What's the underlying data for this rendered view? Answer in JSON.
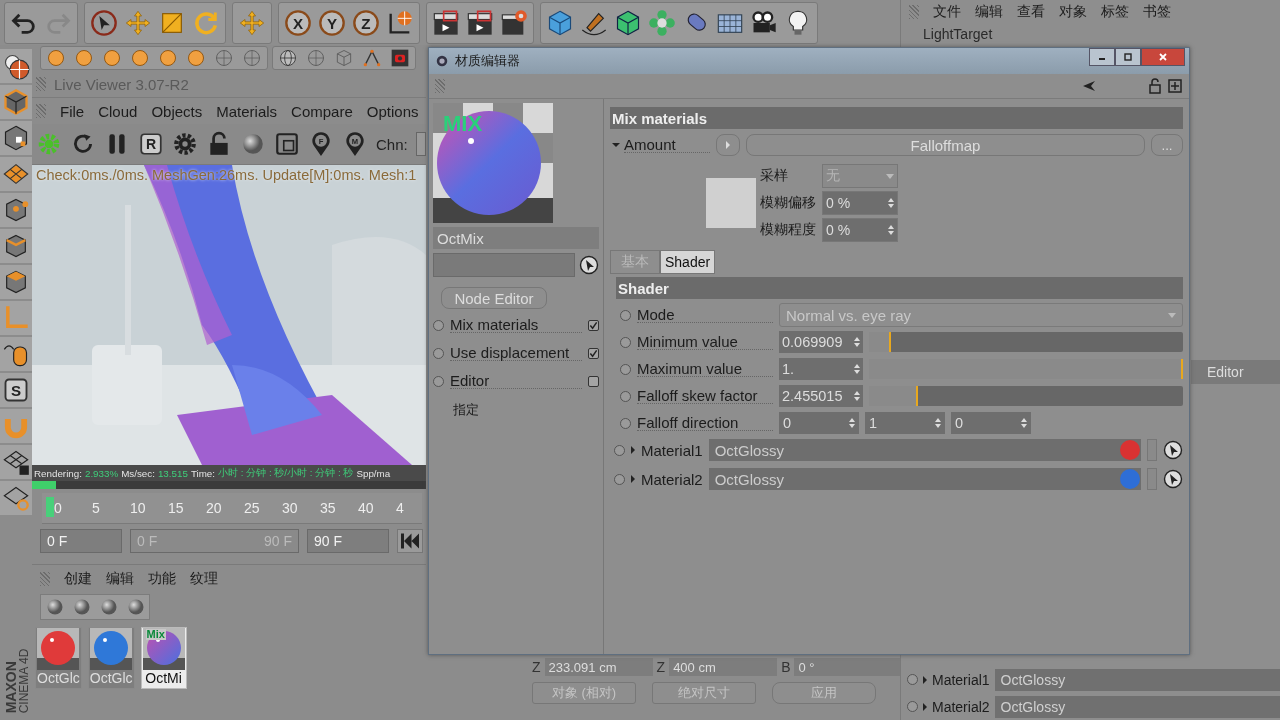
{
  "top_toolbar": [
    [
      {
        "kind": "undo"
      },
      {
        "kind": "redo"
      }
    ],
    [
      {
        "kind": "cursor"
      },
      {
        "kind": "move"
      },
      {
        "kind": "scale"
      },
      {
        "kind": "rotate"
      }
    ],
    [
      {
        "kind": "move"
      }
    ],
    [
      {
        "kind": "axis",
        "label": "X"
      },
      {
        "kind": "axis",
        "label": "Y"
      },
      {
        "kind": "axis",
        "label": "Z"
      },
      {
        "kind": "globe-axis"
      }
    ],
    [
      {
        "kind": "clapper"
      },
      {
        "kind": "clapper"
      },
      {
        "kind": "clapper-gear"
      }
    ],
    [
      {
        "kind": "cube"
      },
      {
        "kind": "pen"
      },
      {
        "kind": "cube-green"
      },
      {
        "kind": "flower"
      },
      {
        "kind": "capsule"
      },
      {
        "kind": "plane"
      },
      {
        "kind": "camera"
      },
      {
        "kind": "bulb"
      }
    ]
  ],
  "second_toolbar": [
    [
      {
        "kind": "sphere-orange"
      },
      {
        "kind": "sphere-orange"
      },
      {
        "kind": "sphere-orange"
      },
      {
        "kind": "sphere-orange"
      },
      {
        "kind": "sphere-orange"
      },
      {
        "kind": "sphere-orange"
      },
      {
        "kind": "sphere-outline"
      },
      {
        "kind": "sphere-outline"
      }
    ],
    [
      {
        "kind": "globe"
      },
      {
        "kind": "sphere-outline"
      },
      {
        "kind": "wire-cube"
      },
      {
        "kind": "vertex"
      },
      {
        "kind": "record"
      }
    ]
  ],
  "left_tools": [
    {
      "kind": "globe-person"
    },
    {
      "kind": "cube-orange"
    },
    {
      "kind": "checker-cube"
    },
    {
      "kind": "grid-orange"
    },
    {
      "kind": "cube-points"
    },
    {
      "kind": "cube-edges"
    },
    {
      "kind": "cube-face"
    },
    {
      "kind": "axis-l"
    },
    {
      "kind": "mouse"
    },
    {
      "kind": "letter",
      "label": "S"
    },
    {
      "kind": "magnet"
    },
    {
      "kind": "grid-lock"
    },
    {
      "kind": "grid-loop"
    }
  ],
  "viewer": {
    "title": "Live Viewer 3.07-R2",
    "menu": [
      "File",
      "Cloud",
      "Objects",
      "Materials",
      "Compare",
      "Options"
    ],
    "tools": [
      {
        "kind": "gear-green"
      },
      {
        "kind": "refresh"
      },
      {
        "kind": "pause"
      },
      {
        "kind": "letter",
        "label": "R"
      },
      {
        "kind": "gear"
      },
      {
        "kind": "lock"
      },
      {
        "kind": "ball"
      },
      {
        "kind": "frame"
      },
      {
        "kind": "pin",
        "label": "F"
      },
      {
        "kind": "pin",
        "label": "M"
      }
    ],
    "channel_label": "Chn:",
    "stats": "Check:0ms./0ms. MeshGen:26ms. Update[M]:0ms. Mesh:1",
    "status": [
      {
        "kind": "label",
        "text": "Rendering:"
      },
      {
        "kind": "value",
        "text": "2.933%"
      },
      {
        "kind": "label",
        "text": "Ms/sec:"
      },
      {
        "kind": "value",
        "text": "13.515"
      },
      {
        "kind": "label",
        "text": "Time:"
      },
      {
        "kind": "value",
        "text": "小时 : 分钟 : 秒/小时 : 分钟 : 秒"
      },
      {
        "kind": "label",
        "text": "Spp/ma"
      }
    ],
    "progress": {
      "level": 0.06
    }
  },
  "timeline": {
    "ticks": [
      "0",
      "5",
      "10",
      "15",
      "20",
      "25",
      "30",
      "35",
      "40",
      "4"
    ],
    "playhead": {
      "level": 0
    },
    "start": "0 F",
    "range_start": "0 F",
    "range_end": "90 F",
    "end": "90 F"
  },
  "material_manager": {
    "menu": [
      "创建",
      "编辑",
      "功能",
      "纹理"
    ],
    "tools": [
      {
        "kind": "ball"
      },
      {
        "kind": "ball"
      },
      {
        "kind": "ball"
      },
      {
        "kind": "ball"
      }
    ],
    "materials": [
      {
        "name": "OctGlc",
        "kind": "sphere",
        "color": "#e03a3a",
        "selected": false
      },
      {
        "name": "OctGlc",
        "kind": "sphere",
        "color": "#2f78d8",
        "selected": false
      },
      {
        "name": "OctMi",
        "kind": "mix",
        "badge": "Mix",
        "selected": true
      }
    ],
    "brand": [
      "MAXON",
      "CINEMA 4D"
    ]
  },
  "coordinates": {
    "fields": [
      {
        "axis": "Z",
        "value": "233.091 cm"
      },
      {
        "axis": "Z",
        "value": "400 cm"
      },
      {
        "axis": "B",
        "value": "0 °"
      }
    ],
    "dropdowns": [
      "对象 (相对)",
      "绝对尺寸"
    ],
    "apply": "应用"
  },
  "right_panel": {
    "menu": [
      "文件",
      "编辑",
      "查看",
      "对象",
      "标签",
      "书签"
    ],
    "object": "LightTarget",
    "editor_label": "Editor",
    "materials": [
      {
        "label": "Material1",
        "value": "OctGlossy"
      },
      {
        "label": "Material2",
        "value": "OctGlossy"
      }
    ]
  },
  "dialog": {
    "title": "材质编辑器",
    "preview_badge": "MIX",
    "name": "OctMix",
    "node_editor": "Node Editor",
    "channels": [
      {
        "label": "Mix materials",
        "checked": true
      },
      {
        "label": "Use displacement",
        "checked": true
      },
      {
        "label": "Editor",
        "checked": false
      }
    ],
    "assign": "指定",
    "section": "Mix materials",
    "amount": {
      "label": "Amount",
      "shader": "Falloffmap",
      "more": "..."
    },
    "sampling": [
      {
        "kind": "dropdown",
        "label": "采样",
        "value": "无"
      },
      {
        "kind": "spinner",
        "label": "模糊偏移",
        "value": "0 %"
      },
      {
        "kind": "spinner",
        "label": "模糊程度",
        "value": "0 %"
      }
    ],
    "tabs": [
      {
        "label": "基本",
        "selected": false
      },
      {
        "label": "Shader",
        "selected": true
      }
    ],
    "shader_header": "Shader",
    "params": [
      {
        "kind": "dropdown",
        "label": "Mode",
        "value": "Normal vs. eye ray"
      },
      {
        "kind": "slider",
        "label": "Minimum value",
        "value": "0.069909",
        "level": 0.07
      },
      {
        "kind": "slider",
        "label": "Maximum value",
        "value": "1.",
        "level": 1
      },
      {
        "kind": "slider",
        "label": "Falloff skew factor",
        "value": "2.455015",
        "level": 0.155
      },
      {
        "kind": "vector",
        "label": "Falloff direction",
        "values": [
          "0",
          "1",
          "0"
        ]
      }
    ],
    "materials": [
      {
        "label": "Material1",
        "value": "OctGlossy",
        "color": "#d93232"
      },
      {
        "label": "Material2",
        "value": "OctGlossy",
        "color": "#2e6ed6"
      }
    ]
  }
}
